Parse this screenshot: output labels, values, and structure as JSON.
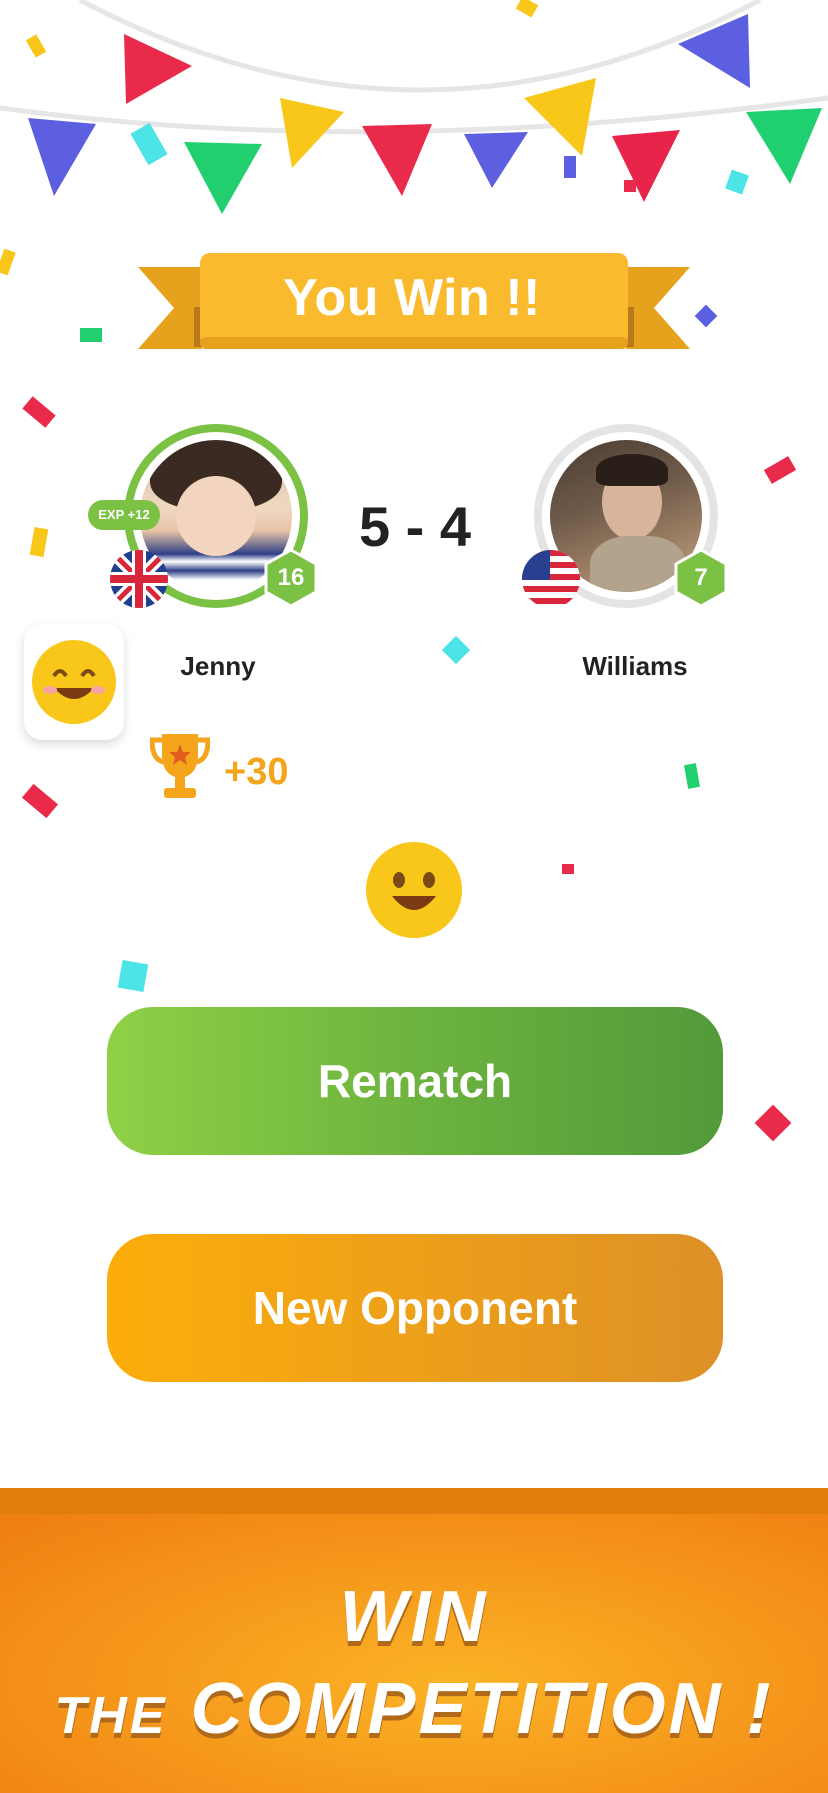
{
  "banner": {
    "title": "You Win !!"
  },
  "players": {
    "left": {
      "name": "Jenny",
      "level": "16",
      "exp": "EXP +12"
    },
    "right": {
      "name": "Williams",
      "level": "7"
    }
  },
  "score": "5 - 4",
  "reward": {
    "trophy_points": "+30"
  },
  "buttons": {
    "rematch": "Rematch",
    "new_opponent": "New Opponent"
  },
  "footer": {
    "line1": "WIN",
    "line2_prefix": "THE",
    "line2_main": "COMPETITION !"
  },
  "colors": {
    "accent_green": "#7bc143",
    "accent_orange": "#f4a51c",
    "banner_yellow": "#f9bb2d"
  },
  "icons": [
    "trophy-icon",
    "smiley-emoji-icon",
    "uk-flag-icon",
    "us-flag-icon",
    "level-hex-icon"
  ]
}
